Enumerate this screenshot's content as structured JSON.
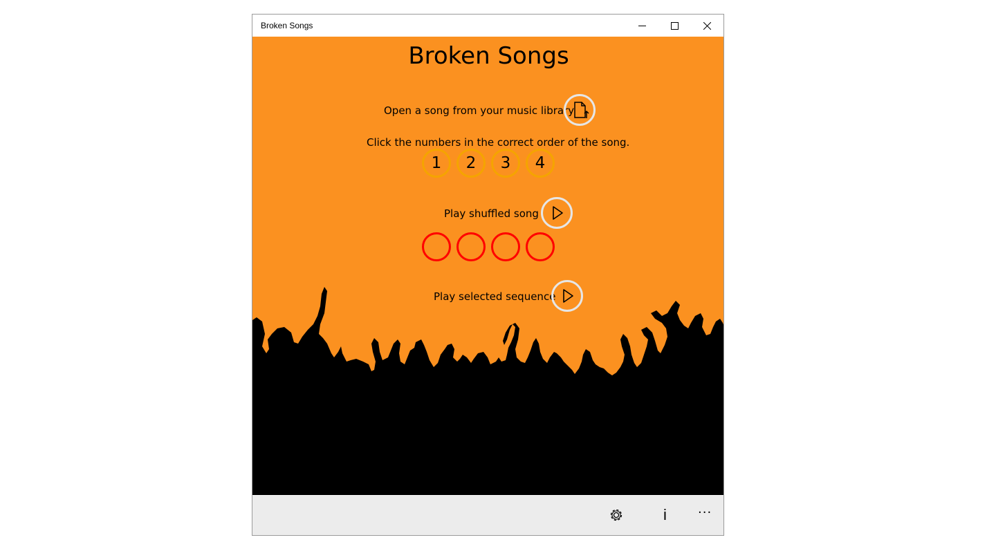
{
  "window": {
    "title": "Broken Songs",
    "minimize_icon": "minimize-icon",
    "maximize_icon": "maximize-icon",
    "close_icon": "close-icon"
  },
  "main": {
    "heading": "Broken Songs",
    "open_label": "Open a song from your music library",
    "open_icon": "open-file-icon",
    "instructions": "Click the numbers in the correct order of the song.",
    "number_buttons": [
      "1",
      "2",
      "3",
      "4"
    ],
    "play_shuffled_label": "Play shuffled song",
    "play_selected_label": "Play selected sequence",
    "play_icon": "play-icon",
    "selection_slots": 4
  },
  "command_bar": {
    "settings_icon": "gear-icon",
    "info_label": "i",
    "more_label": "···"
  },
  "colors": {
    "background": "#fb9120",
    "number_ring": "#f5a400",
    "slot_ring": "#ff0000",
    "button_ring": "#e6e6e6",
    "crowd": "#000000"
  }
}
